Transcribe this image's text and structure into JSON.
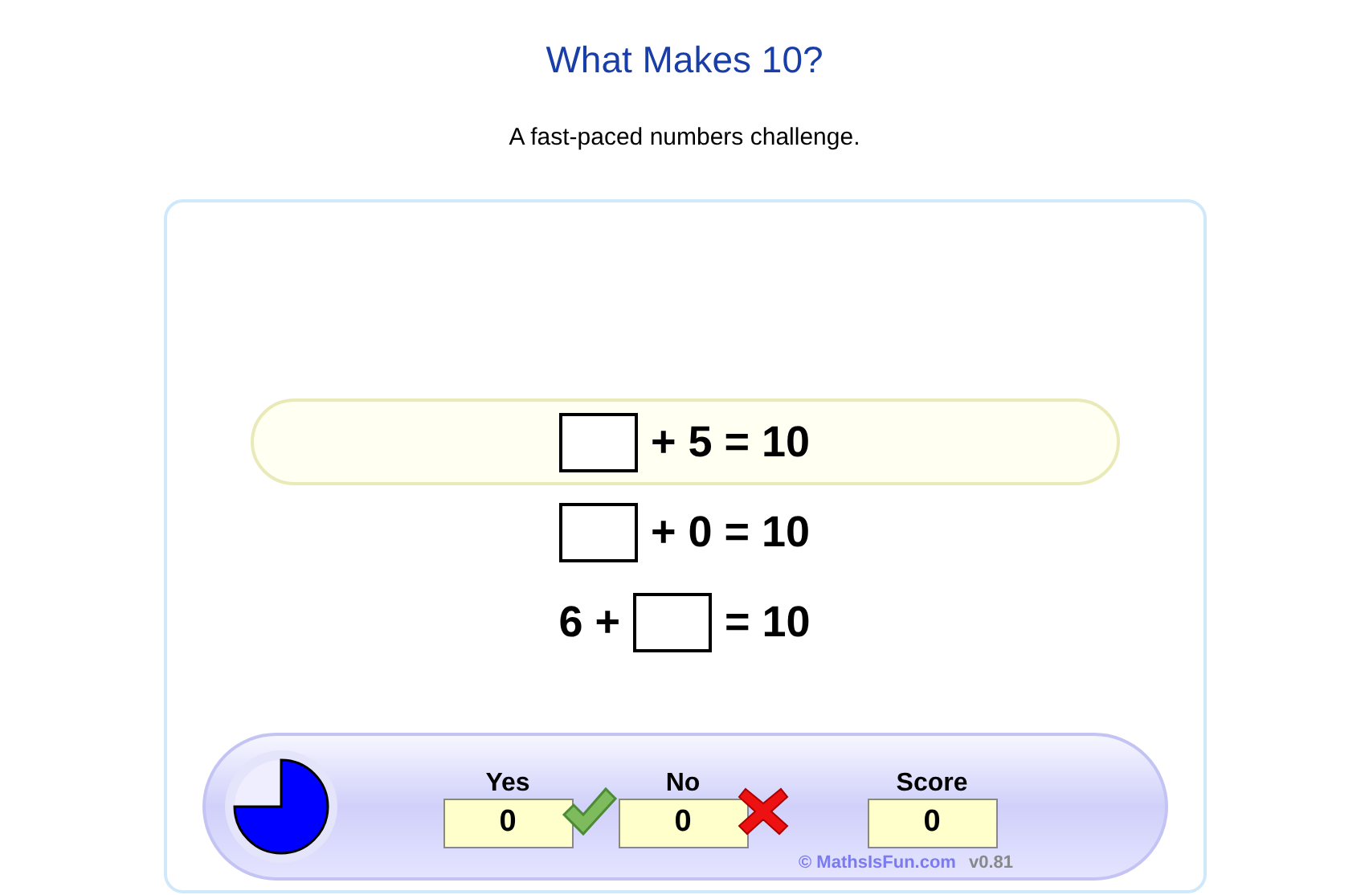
{
  "title": "What Makes 10?",
  "subtitle": "A fast-paced numbers challenge.",
  "equations": [
    {
      "after": "+ 5 = 10",
      "selected": true
    },
    {
      "after": "+ 0 = 10",
      "selected": false
    },
    {
      "before": "6 +",
      "after": "= 10",
      "selected": false
    }
  ],
  "scores": [
    {
      "label": "Yes",
      "value": "0",
      "kind": "yes"
    },
    {
      "label": "No",
      "value": "0",
      "kind": "no"
    },
    {
      "label": "Score",
      "value": "0",
      "kind": "score"
    }
  ],
  "credit": "© MathsIsFun.com",
  "version": "v0.81"
}
